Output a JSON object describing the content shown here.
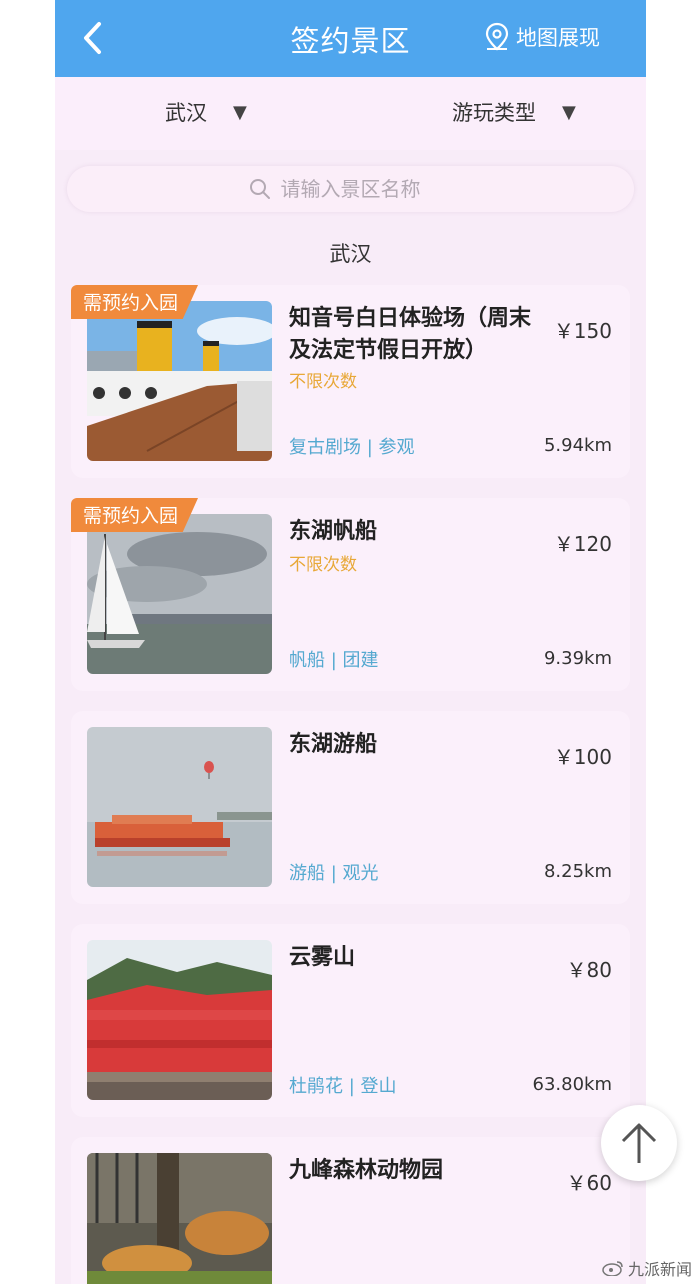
{
  "header": {
    "title": "签约景区",
    "map_label": "地图展现"
  },
  "filters": {
    "city": "武汉",
    "type": "游玩类型"
  },
  "search": {
    "placeholder": "请输入景区名称"
  },
  "section_title": "武汉",
  "items": [
    {
      "badge": "需预约入园",
      "name": "知音号白日体验场（周末及法定节假日开放）",
      "price": "￥150",
      "limit": "不限次数",
      "tags": "复古剧场 | 参观",
      "distance": "5.94km"
    },
    {
      "badge": "需预约入园",
      "name": "东湖帆船",
      "price": "￥120",
      "limit": "不限次数",
      "tags": "帆船 | 团建",
      "distance": "9.39km"
    },
    {
      "name": "东湖游船",
      "price": "￥100",
      "tags": "游船 | 观光",
      "distance": "8.25km"
    },
    {
      "name": "云雾山",
      "price": "￥80",
      "tags": "杜鹃花 | 登山",
      "distance": "63.80km"
    },
    {
      "name": "九峰森林动物园",
      "price": "￥60"
    }
  ],
  "watermark": "九派新闻",
  "colors": {
    "header": "#4fa6ee",
    "badge": "#f08a3c",
    "limit": "#e8a838",
    "tags": "#55a9d0"
  },
  "icons": {
    "back": "chevron-left-icon",
    "map": "map-pin-icon",
    "search": "search-icon",
    "scroll_top": "arrow-up-icon"
  }
}
